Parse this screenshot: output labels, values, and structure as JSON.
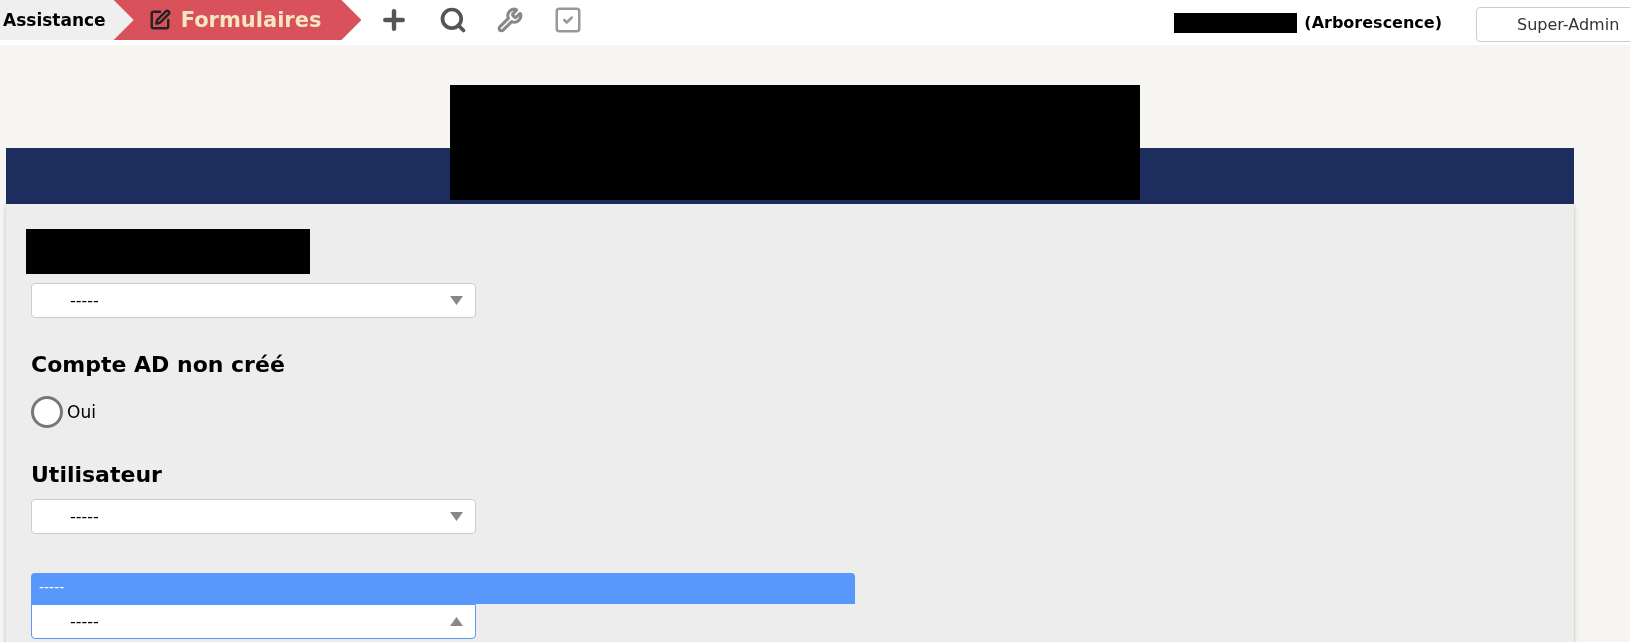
{
  "breadcrumbs": [
    {
      "label": "Assistance",
      "selected": false
    },
    {
      "label": "Formulaires",
      "selected": true
    }
  ],
  "user": {
    "name_redacted": true,
    "context": "(Arborescence)"
  },
  "profile_button": "Super-Admin",
  "header": {
    "title_redacted": true
  },
  "fields": [
    {
      "kind": "select",
      "label_redacted": true,
      "value": "-----",
      "expanded": false
    },
    {
      "kind": "radio",
      "label": "Compte AD non créé",
      "options": [
        {
          "label": "Oui",
          "selected": false
        }
      ]
    },
    {
      "kind": "select",
      "label": "Utilisateur",
      "value": "-----",
      "expanded": false
    },
    {
      "kind": "select",
      "value": "-----",
      "expanded": true,
      "options": [
        {
          "label": "-----",
          "highlighted": true
        }
      ]
    }
  ]
}
